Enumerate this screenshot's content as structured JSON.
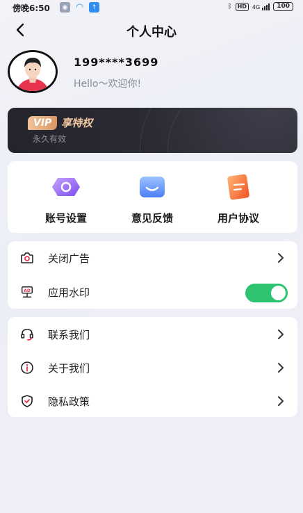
{
  "status_bar": {
    "time": "傍晚6:50",
    "hd": "HD",
    "network": "4G",
    "battery": "100"
  },
  "header": {
    "title": "个人中心"
  },
  "profile": {
    "phone": "199****3699",
    "greeting": "Hello～欢迎你!"
  },
  "vip": {
    "badge": "VIP",
    "title": "享特权",
    "subtitle": "永久有效"
  },
  "quick_actions": [
    {
      "label": "账号设置",
      "icon": "account-settings-icon"
    },
    {
      "label": "意见反馈",
      "icon": "feedback-icon"
    },
    {
      "label": "用户协议",
      "icon": "user-agreement-icon"
    }
  ],
  "settings_group": [
    {
      "label": "关闭广告",
      "icon": "camera-icon"
    },
    {
      "label": "应用水印",
      "icon": "watermark-icon",
      "toggle_on": true
    }
  ],
  "info_group": [
    {
      "label": "联系我们",
      "icon": "headset-icon"
    },
    {
      "label": "关于我们",
      "icon": "info-icon"
    },
    {
      "label": "隐私政策",
      "icon": "shield-icon"
    }
  ],
  "colors": {
    "toggle_on": "#2ec36f",
    "vip_gold": "#f2c8a0",
    "vip_card": "#2b2b35"
  }
}
